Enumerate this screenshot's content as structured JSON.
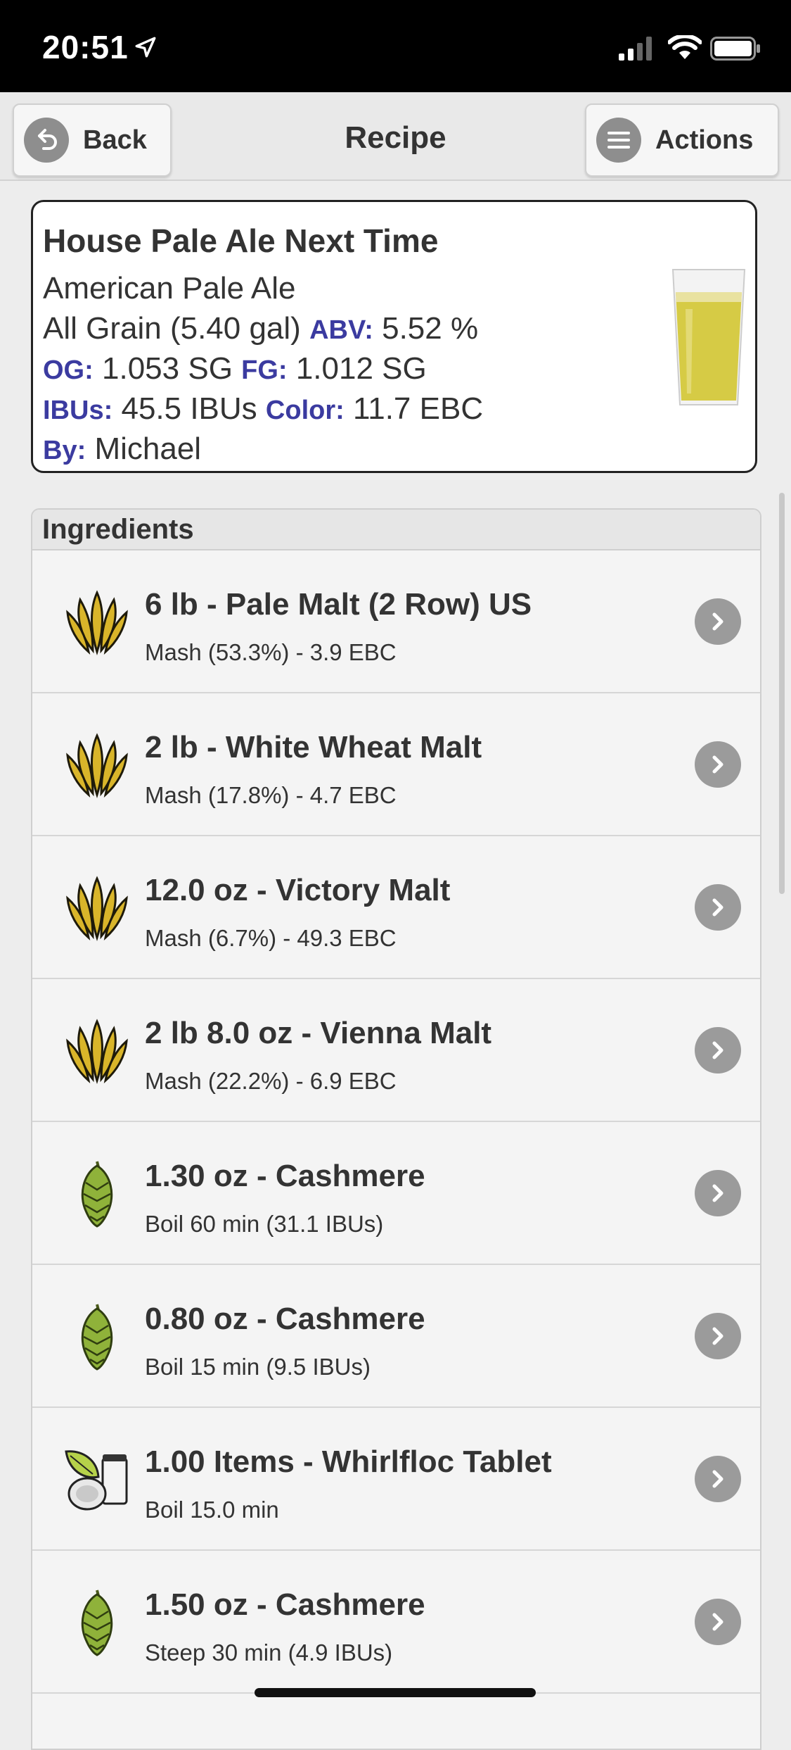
{
  "status_bar": {
    "time": "20:51"
  },
  "nav": {
    "back_label": "Back",
    "title": "Recipe",
    "actions_label": "Actions"
  },
  "summary": {
    "name": "House Pale Ale Next Time",
    "style": "American Pale Ale",
    "type_batch": "All Grain (5.40 gal)",
    "abv_label": "ABV:",
    "abv_value": "5.52 %",
    "og_label": "OG:",
    "og_value": "1.053 SG",
    "fg_label": "FG:",
    "fg_value": "1.012 SG",
    "ibu_label": "IBUs:",
    "ibu_value": "45.5 IBUs",
    "color_label": "Color:",
    "color_value": "11.7 EBC",
    "by_label": "By:",
    "by_value": "Michael"
  },
  "ingredients": {
    "header": "Ingredients",
    "items": [
      {
        "title": "6 lb - Pale Malt (2 Row) US",
        "subtitle": "Mash (53.3%) - 3.9 EBC",
        "icon": "grain-icon"
      },
      {
        "title": "2 lb - White Wheat Malt",
        "subtitle": "Mash (17.8%) - 4.7 EBC",
        "icon": "grain-icon"
      },
      {
        "title": "12.0 oz - Victory Malt",
        "subtitle": "Mash (6.7%) - 49.3 EBC",
        "icon": "grain-icon"
      },
      {
        "title": "2 lb 8.0 oz - Vienna Malt",
        "subtitle": "Mash (22.2%) - 6.9 EBC",
        "icon": "grain-icon"
      },
      {
        "title": "1.30 oz - Cashmere",
        "subtitle": "Boil 60 min (31.1 IBUs)",
        "icon": "hop-icon"
      },
      {
        "title": "0.80 oz - Cashmere",
        "subtitle": "Boil 15 min (9.5 IBUs)",
        "icon": "hop-icon"
      },
      {
        "title": "1.00 Items - Whirlfloc Tablet",
        "subtitle": "Boil 15.0 min",
        "icon": "misc-icon"
      },
      {
        "title": "1.50 oz - Cashmere",
        "subtitle": "Steep 30 min (4.9 IBUs)",
        "icon": "hop-icon"
      }
    ]
  }
}
